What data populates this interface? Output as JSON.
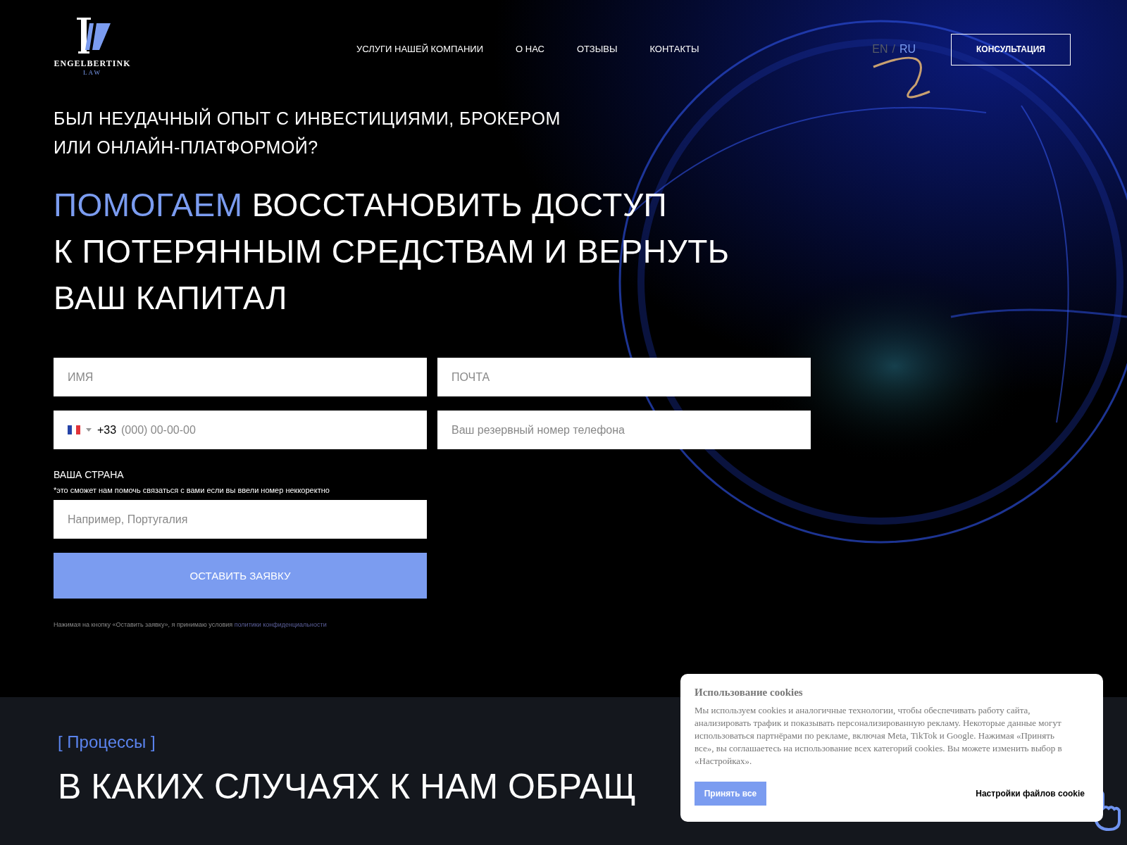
{
  "header": {
    "logo": {
      "name": "ENGELBERTINK",
      "sub": "LAW"
    },
    "nav": [
      {
        "label": "УСЛУГИ НАШЕЙ КОМПАНИИ"
      },
      {
        "label": "О НАС"
      },
      {
        "label": "ОТЗЫВЫ"
      },
      {
        "label": "КОНТАКТЫ"
      }
    ],
    "languages": [
      {
        "label": "EN",
        "selected": false
      },
      {
        "label": "RU",
        "selected": true
      }
    ],
    "language_separator": "/",
    "cta": "КОНСУЛЬТАЦИЯ"
  },
  "hero": {
    "subtitle_lines": [
      "БЫЛ НЕУДАЧНЫЙ ОПЫТ С ИНВЕСТИЦИЯМИ, БРОКЕРОМ",
      "ИЛИ ОНЛАЙН-ПЛАТФОРМОЙ?"
    ],
    "title_accent": "ПОМОГАЕМ",
    "title_lines": [
      "ВОССТАНОВИТЬ ДОСТУП",
      "К ПОТЕРЯННЫМ СРЕДСТВАМ И ВЕРНУТЬ",
      "ВАШ КАПИТАЛ"
    ],
    "form": {
      "name": {
        "placeholder": "ИМЯ"
      },
      "email": {
        "placeholder": "ПОЧТА"
      },
      "phone": {
        "code": "+33",
        "placeholder": "(000) 00-00-00"
      },
      "backup_phone": {
        "placeholder": "Ваш резервный номер телефона"
      },
      "country_label": "ВАША СТРАНА",
      "country_note": "*это сможет нам помочь связаться с вами если вы ввели номер неккоректно",
      "country": {
        "placeholder": "Например, Португалия"
      },
      "submit": "ОСТАВИТЬ ЗАЯВКУ",
      "consent": "Нажимая на кнопку «Оставить заявку», я принимаю условия",
      "consent_link": "политики конфиденциальности"
    }
  },
  "processes": {
    "tag": "[ Процессы ]",
    "title": "В КАКИХ СЛУЧАЯХ К НАМ ОБРАЩ"
  },
  "cookie_banner": {
    "title": "Использование cookies",
    "text": "Мы используем cookies и аналогичные технологии, чтобы обеспечивать работу сайта, анализировать трафик и показывать персонализированную рекламу. Некоторые данные могут использоваться партнёрами по рекламе, включая Meta, TikTok и Google. Нажимая «Принять все», вы соглашаетесь на использование всех категорий cookies. Вы можете изменить выбор в «Настройках».",
    "accept": "Принять все",
    "settings": "Настройки файлов cookie"
  }
}
